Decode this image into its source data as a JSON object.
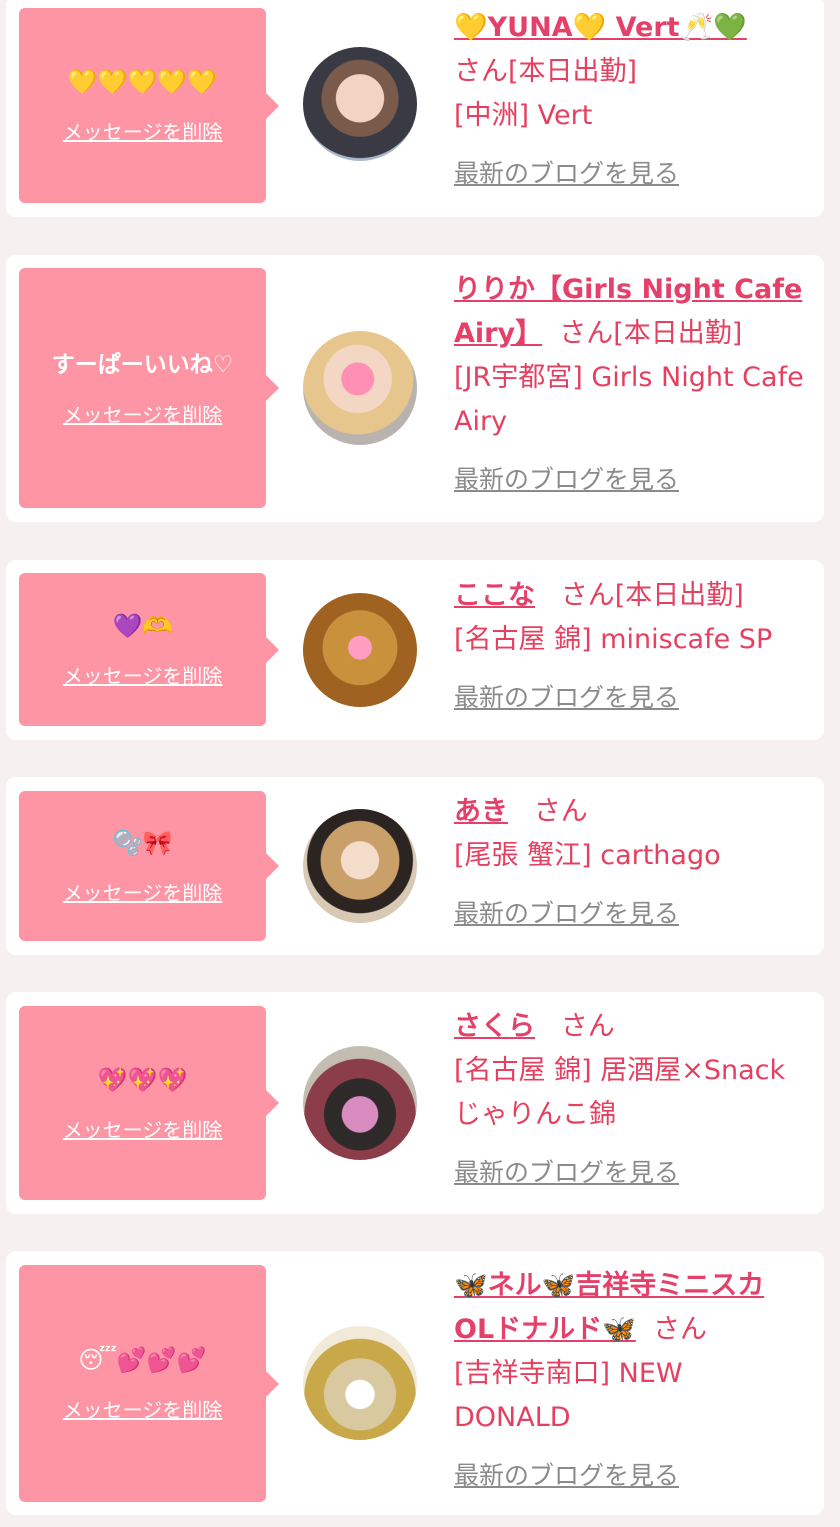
{
  "delete_label": "メッセージを削除",
  "blog_label": "最新のブログを見る",
  "colors": {
    "bubble": "#fd95a4",
    "accent": "#e54060",
    "link_gray": "#8b8b8b",
    "card": "#ffffff",
    "background": "#f6f0f1"
  },
  "messages": [
    {
      "message": "💛💛💛💛💛",
      "name": "💛YUNA💛 Vert🥂💚",
      "suffix": "さん[本日出勤]",
      "shop": "[中洲] Vert"
    },
    {
      "message": "すーぱーいいね♡",
      "name": "りりか【Girls Night Cafe Airy】",
      "suffix": "さん[本日出勤]",
      "shop": "[JR宇都宮] Girls Night Cafe Airy"
    },
    {
      "message": "💜🫶",
      "name": "ここな",
      "suffix": "さん[本日出勤]",
      "shop": "[名古屋 錦] miniscafe SP"
    },
    {
      "message": "🫧🎀",
      "name": "あき",
      "suffix": "さん",
      "shop": "[尾張 蟹江] carthago"
    },
    {
      "message": "💖💖💖",
      "name": "さくら",
      "suffix": "さん",
      "shop": "[名古屋 錦] 居酒屋×Snack じゃりんこ錦"
    },
    {
      "message": "😴💕💕💕",
      "name": "🦋ネル🦋吉祥寺ミニスカOLドナルド🦋",
      "suffix": "さん",
      "shop": "[吉祥寺南口] NEW DONALD"
    }
  ]
}
